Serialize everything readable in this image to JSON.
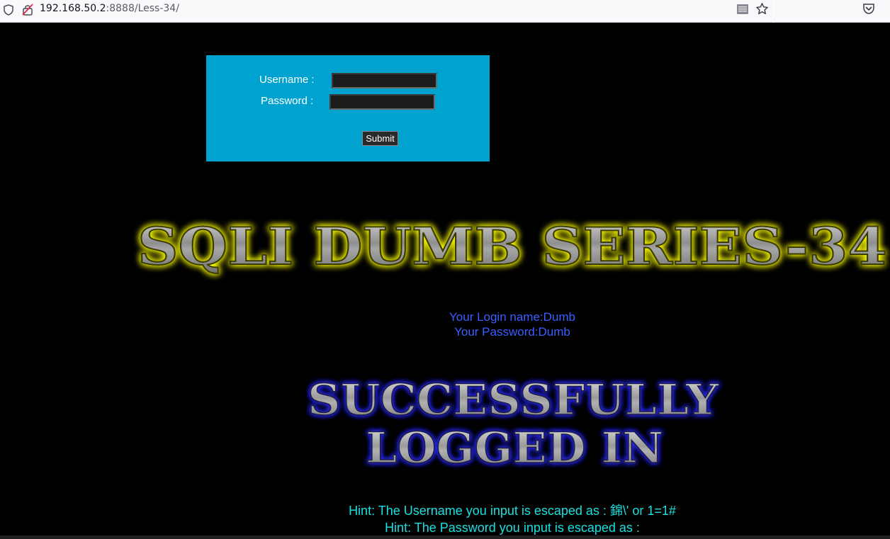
{
  "browser": {
    "url_host": "192.168.50.2",
    "url_rest": ":8888/Less-34/",
    "icons": [
      "shield-icon",
      "insecure-lock-icon",
      "reader-view-icon",
      "bookmark-star-icon",
      "pocket-icon"
    ]
  },
  "login_form": {
    "username_label": "Username :",
    "password_label": "Password :",
    "username_value": "",
    "password_value": "",
    "submit_label": "Submit"
  },
  "page": {
    "title": "SQLI DUMB SERIES-34",
    "login_name": "Your Login name:Dumb",
    "password_text": "Your Password:Dumb",
    "success_line1": "SUCCESSFULLY",
    "success_line2": "LOGGED IN",
    "hint_username": "Hint: The Username you input is escaped as : 錦\\' or 1=1#",
    "hint_password": "Hint: The Password you input is escaped as :"
  },
  "colors": {
    "form_bg": "#00a3cf",
    "title_glow": "#ffff00",
    "success_glow": "#2020ff",
    "result_text": "#3a5fff",
    "hint_text": "#19e0e0"
  }
}
